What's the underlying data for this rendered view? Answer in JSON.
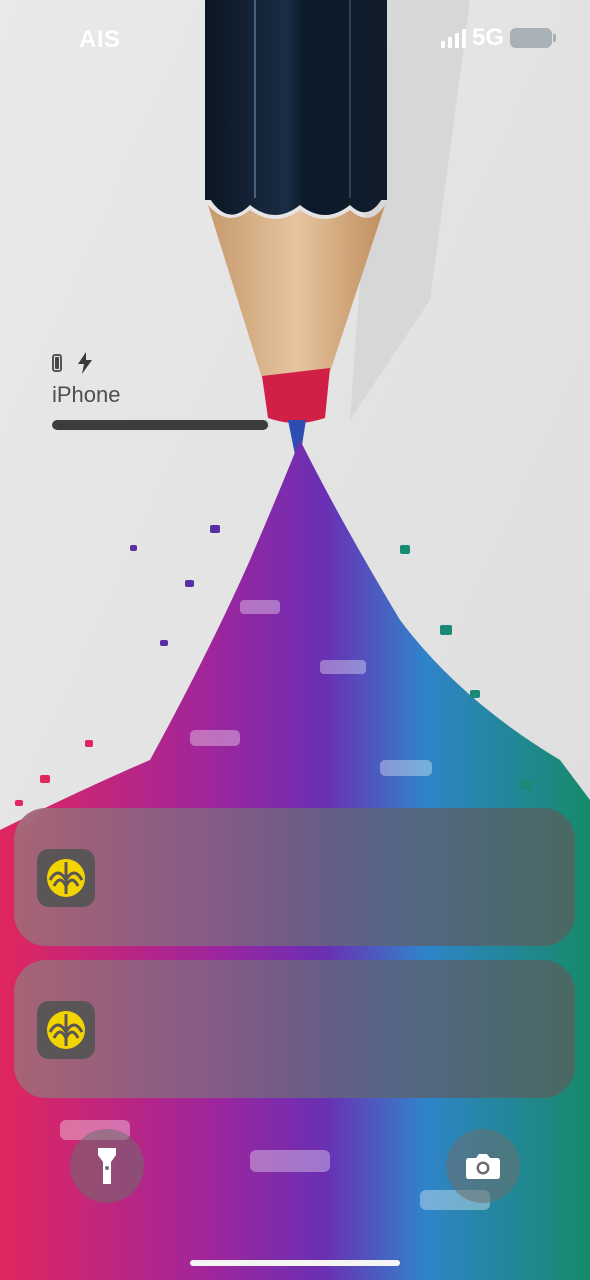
{
  "status_bar": {
    "carrier": "AIS",
    "network": "5G",
    "signal_bars": 4,
    "icons": [
      "signal-icon",
      "battery-icon"
    ]
  },
  "device_widget": {
    "name": "iPhone",
    "icons": [
      "phone-icon",
      "charging-bolt-icon"
    ],
    "battery_level": 0.99
  },
  "notifications": [
    {
      "app_icon": "bank-app-icon"
    },
    {
      "app_icon": "bank-app-icon"
    }
  ],
  "quick_actions": [
    "flashlight-icon",
    "camera-icon"
  ],
  "colors": {
    "accent_yellow": "#f4d400",
    "pencil_wood": "#d9b58c",
    "pencil_body": "#0c1a2a"
  }
}
